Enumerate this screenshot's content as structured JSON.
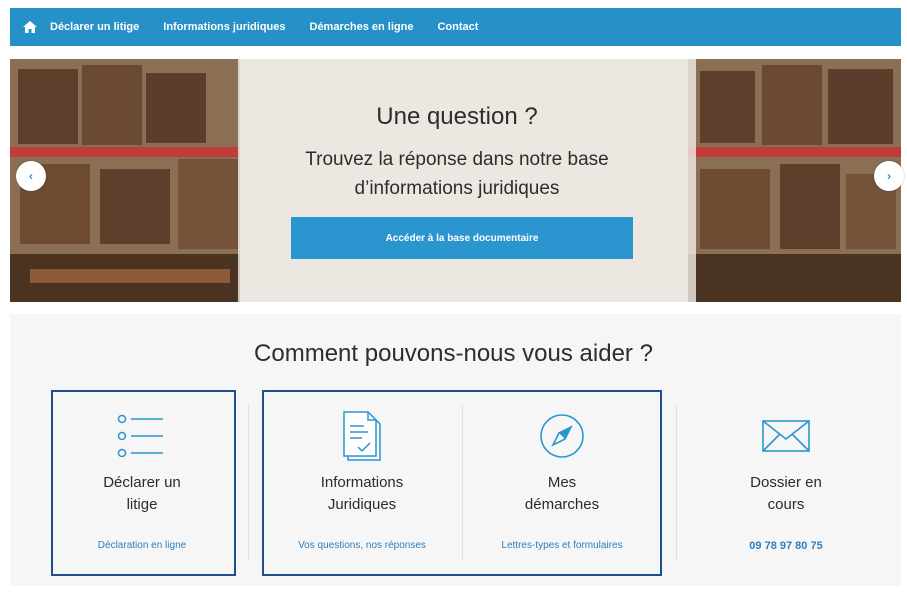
{
  "nav": {
    "home_icon": "home-icon",
    "items": [
      "Déclarer un litige",
      "Informations juridiques",
      "Démarches en ligne",
      "Contact"
    ]
  },
  "hero": {
    "title": "Une question ?",
    "subtitle": "Trouvez la réponse dans notre base d’informations juridiques",
    "button_label": "Accéder à la base documentaire",
    "prev_label": "‹",
    "next_label": "›"
  },
  "section": {
    "title": "Comment pouvons-nous vous aider ?",
    "cards": [
      {
        "title_line1": "Déclarer un",
        "title_line2": "litige",
        "link": "Déclaration en ligne",
        "icon": "list-icon"
      },
      {
        "title_line1": "Informations",
        "title_line2": "Juridiques",
        "link": "Vos questions, nos réponses",
        "icon": "document-icon"
      },
      {
        "title_line1": "Mes",
        "title_line2": "démarches",
        "link": "Lettres-types et formulaires",
        "icon": "compass-icon"
      },
      {
        "title_line1": "Dossier en",
        "title_line2": "cours",
        "link": "09 78 97 80 75",
        "icon": "envelope-icon"
      }
    ]
  },
  "colors": {
    "nav_bg": "#2690c8",
    "accent": "#2b95cf",
    "link": "#2b7fc1",
    "highlight_border": "#1e4e8c"
  }
}
